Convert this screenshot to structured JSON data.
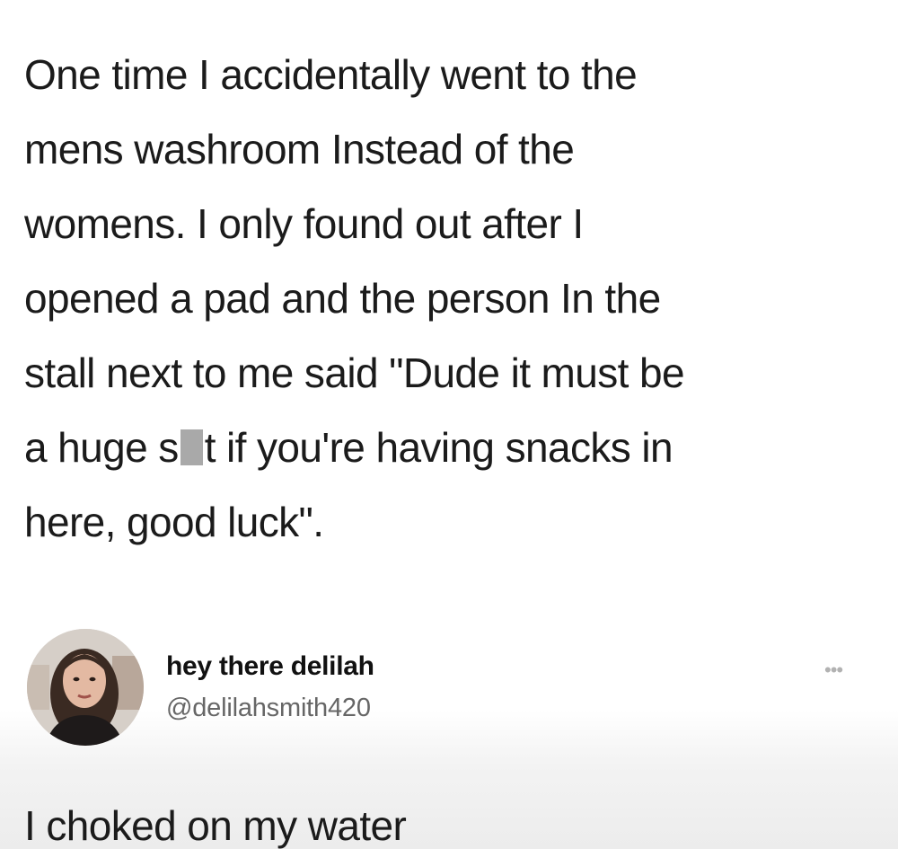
{
  "tweet": {
    "lines": [
      "One time I accidentally went to the",
      "mens washroom Instead of the",
      "womens. I only found out after I",
      "opened a pad and the person In the",
      "stall next to me said \"Dude it must be"
    ],
    "line6_before": "a huge s",
    "line6_after": "t if you're having snacks in",
    "line7": "here, good luck\"."
  },
  "reply": {
    "display_name": "hey there delilah",
    "handle": "@delilahsmith420",
    "more_icon": "more-options-icon",
    "text": "I choked on my water"
  },
  "colors": {
    "text": "#1b1b1b",
    "handle": "#666666",
    "censor": "#a9a9a9"
  }
}
